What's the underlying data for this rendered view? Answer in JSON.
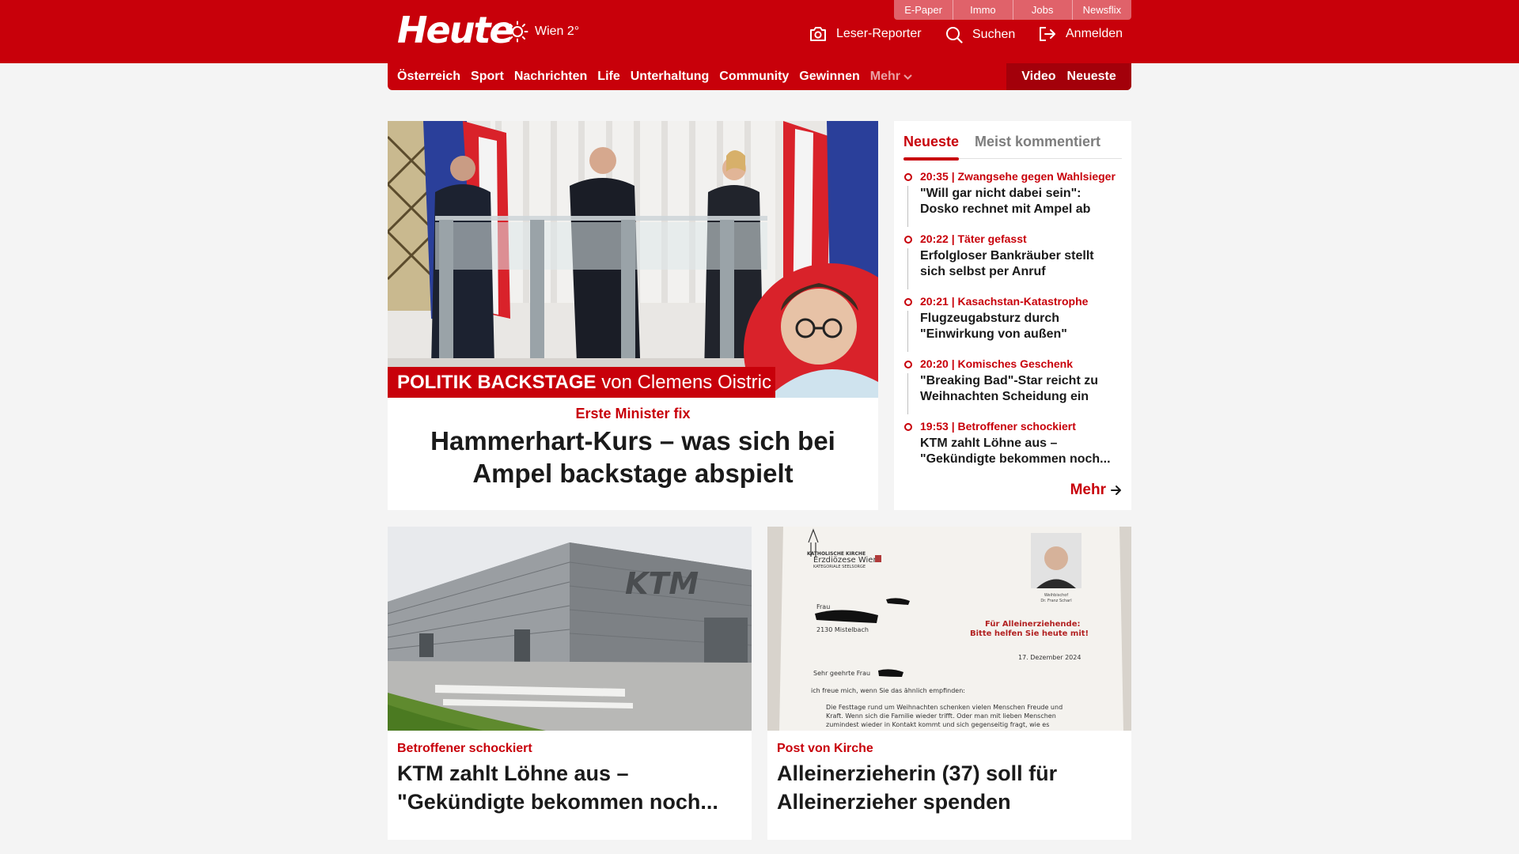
{
  "header": {
    "logo": "Heute",
    "weather": {
      "icon": "sun-icon",
      "text": "Wien 2°"
    },
    "top_tabs": [
      "E-Paper",
      "Immo",
      "Jobs",
      "Newsflix"
    ],
    "actions": [
      {
        "icon": "camera-icon",
        "label": "Leser-Reporter"
      },
      {
        "icon": "search-icon",
        "label": "Suchen"
      },
      {
        "icon": "login-icon",
        "label": "Anmelden"
      }
    ],
    "brand_color": "#c8000a"
  },
  "nav": {
    "items": [
      "Österreich",
      "Sport",
      "Nachrichten",
      "Life",
      "Unterhaltung",
      "Community",
      "Gewinnen"
    ],
    "more": "Mehr",
    "right": [
      "Video",
      "Neueste"
    ]
  },
  "hero": {
    "banner_strong": "POLITIK BACKSTAGE",
    "banner_rest": " von Clemens Oistric",
    "kicker": "Erste Minister fix",
    "title": "Hammerhart-Kurs – was sich bei Ampel backstage abspielt"
  },
  "sidebar": {
    "tabs": [
      "Neueste",
      "Meist kommentiert"
    ],
    "items": [
      {
        "meta": "20:35 | Zwangsehe gegen Wahlsieger",
        "title": "\"Will gar nicht dabei sein\": Dosko rechnet mit Ampel ab"
      },
      {
        "meta": "20:22 | Täter gefasst",
        "title": "Erfolgloser Bankräuber stellt sich selbst per Anruf"
      },
      {
        "meta": "20:21 | Kasachstan-Katastrophe",
        "title": "Flugzeugabsturz durch \"Einwirkung von außen\""
      },
      {
        "meta": "20:20 | Komisches Geschenk",
        "title": "\"Breaking Bad\"-Star reicht zu Weihnachten Scheidung ein"
      },
      {
        "meta": "19:53 | Betroffener schockiert",
        "title": "KTM zahlt Löhne aus – \"Gekündigte bekommen noch..."
      }
    ],
    "more": "Mehr"
  },
  "cards": [
    {
      "kicker": "Betroffener schockiert",
      "title": "KTM zahlt Löhne aus – \"Gekündigte bekommen noch...",
      "image_text": "KTM"
    },
    {
      "kicker": "Post von Kirche",
      "title": "Alleinerzieherin (37) soll für Alleinerzieher spenden",
      "letter": {
        "org1": "KATHOLISCHE KIRCHE",
        "org2": "Erzdiözese Wien",
        "org3": "KATEGORIALE SEELSORGE",
        "to": "Frau",
        "city": "2130 Mistelbach",
        "heading1": "Für Alleinerziehende:",
        "heading2": "Bitte helfen Sie heute mit!",
        "date": "17. Dezember 2024",
        "salutation": "Sehr geehrte Frau",
        "line1": "ich freue mich, wenn Sie das ähnlich empfinden:",
        "body1": "Die Festtage rund um Weihnachten schenken vielen Menschen Freude und",
        "body2": "Kraft. Wenn sich die Familie wieder trifft. Oder man mit lieben Menschen",
        "body3": "zumindest wieder in Kontakt kommt und sich gegenseitig fragt, wie es",
        "photo_caption1": "Weihbischof",
        "photo_caption2": "Dr. Franz Scharl"
      }
    }
  ]
}
